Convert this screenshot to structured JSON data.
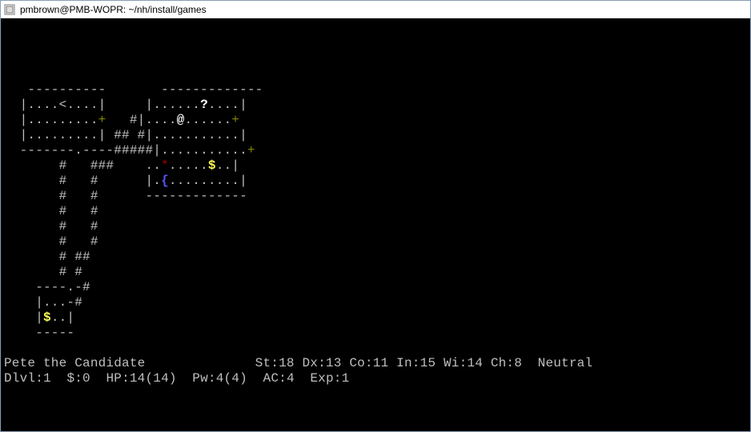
{
  "window": {
    "title": "pmbrown@PMB-WOPR: ~/nh/install/games"
  },
  "map": {
    "rows": [
      [
        {
          "t": "   ----------       -------------",
          "c": "w"
        }
      ],
      [
        {
          "t": "  |....",
          "c": "w"
        },
        {
          "t": "<",
          "c": "w"
        },
        {
          "t": "....|     |......",
          "c": "w"
        },
        {
          "t": "?",
          "c": "bw"
        },
        {
          "t": "....|",
          "c": "w"
        }
      ],
      [
        {
          "t": "  |.........",
          "c": "w"
        },
        {
          "t": "+",
          "c": "y"
        },
        {
          "t": "   ",
          "c": "w"
        },
        {
          "t": "#",
          "c": "w"
        },
        {
          "t": "|....",
          "c": "w"
        },
        {
          "t": "@",
          "c": "bw"
        },
        {
          "t": "......",
          "c": "w"
        },
        {
          "t": "+",
          "c": "y"
        }
      ],
      [
        {
          "t": "  |.........| ",
          "c": "w"
        },
        {
          "t": "##",
          "c": "w"
        },
        {
          "t": " ",
          "c": "w"
        },
        {
          "t": "#",
          "c": "w"
        },
        {
          "t": "|...........|",
          "c": "w"
        }
      ],
      [
        {
          "t": "  -------",
          "c": "w"
        },
        {
          "t": ".",
          "c": "w"
        },
        {
          "t": "----",
          "c": "w"
        },
        {
          "t": "#####",
          "c": "w"
        },
        {
          "t": "|...........",
          "c": "w"
        },
        {
          "t": "+",
          "c": "y"
        }
      ],
      [
        {
          "t": "       ",
          "c": "w"
        },
        {
          "t": "#",
          "c": "w"
        },
        {
          "t": "   ",
          "c": "w"
        },
        {
          "t": "###",
          "c": "w"
        },
        {
          "t": "    ",
          "c": "w"
        },
        {
          "t": "..",
          "c": "w"
        },
        {
          "t": "*",
          "c": "r"
        },
        {
          "t": ".....",
          "c": "w"
        },
        {
          "t": "$",
          "c": "by"
        },
        {
          "t": "..|",
          "c": "w"
        }
      ],
      [
        {
          "t": "       ",
          "c": "w"
        },
        {
          "t": "#",
          "c": "w"
        },
        {
          "t": "   ",
          "c": "w"
        },
        {
          "t": "#",
          "c": "w"
        },
        {
          "t": "      |.",
          "c": "w"
        },
        {
          "t": "{",
          "c": "b"
        },
        {
          "t": ".........|",
          "c": "w"
        }
      ],
      [
        {
          "t": "       ",
          "c": "w"
        },
        {
          "t": "#",
          "c": "w"
        },
        {
          "t": "   ",
          "c": "w"
        },
        {
          "t": "#",
          "c": "w"
        },
        {
          "t": "      -------------",
          "c": "w"
        }
      ],
      [
        {
          "t": "       ",
          "c": "w"
        },
        {
          "t": "#",
          "c": "w"
        },
        {
          "t": "   ",
          "c": "w"
        },
        {
          "t": "#",
          "c": "w"
        }
      ],
      [
        {
          "t": "       ",
          "c": "w"
        },
        {
          "t": "#",
          "c": "w"
        },
        {
          "t": "   ",
          "c": "w"
        },
        {
          "t": "#",
          "c": "w"
        }
      ],
      [
        {
          "t": "       ",
          "c": "w"
        },
        {
          "t": "#",
          "c": "w"
        },
        {
          "t": "   ",
          "c": "w"
        },
        {
          "t": "#",
          "c": "w"
        }
      ],
      [
        {
          "t": "       ",
          "c": "w"
        },
        {
          "t": "#",
          "c": "w"
        },
        {
          "t": " ",
          "c": "w"
        },
        {
          "t": "##",
          "c": "w"
        }
      ],
      [
        {
          "t": "       ",
          "c": "w"
        },
        {
          "t": "#",
          "c": "w"
        },
        {
          "t": " ",
          "c": "w"
        },
        {
          "t": "#",
          "c": "w"
        }
      ],
      [
        {
          "t": "    ----",
          "c": "w"
        },
        {
          "t": ".",
          "c": "w"
        },
        {
          "t": "-",
          "c": "w"
        },
        {
          "t": "#",
          "c": "w"
        }
      ],
      [
        {
          "t": "    |...-",
          "c": "w"
        },
        {
          "t": "#",
          "c": "w"
        }
      ],
      [
        {
          "t": "    |",
          "c": "w"
        },
        {
          "t": "$",
          "c": "by"
        },
        {
          "t": "..|",
          "c": "w"
        }
      ],
      [
        {
          "t": "    -----",
          "c": "w"
        }
      ]
    ]
  },
  "status": {
    "name": "Pete the Candidate",
    "st_label": "St:",
    "st": "18",
    "dx_label": "Dx:",
    "dx": "13",
    "co_label": "Co:",
    "co": "11",
    "in_label": "In:",
    "in": "15",
    "wi_label": "Wi:",
    "wi": "14",
    "ch_label": "Ch:",
    "ch": "8",
    "alignment": "Neutral",
    "dlvl_label": "Dlvl:",
    "dlvl": "1",
    "gold_label": "$:",
    "gold": "0",
    "hp_label": "HP:",
    "hp": "14(14)",
    "pw_label": "Pw:",
    "pw": "4(4)",
    "ac_label": "AC:",
    "ac": "4",
    "exp_label": "Exp:",
    "exp": "1"
  }
}
